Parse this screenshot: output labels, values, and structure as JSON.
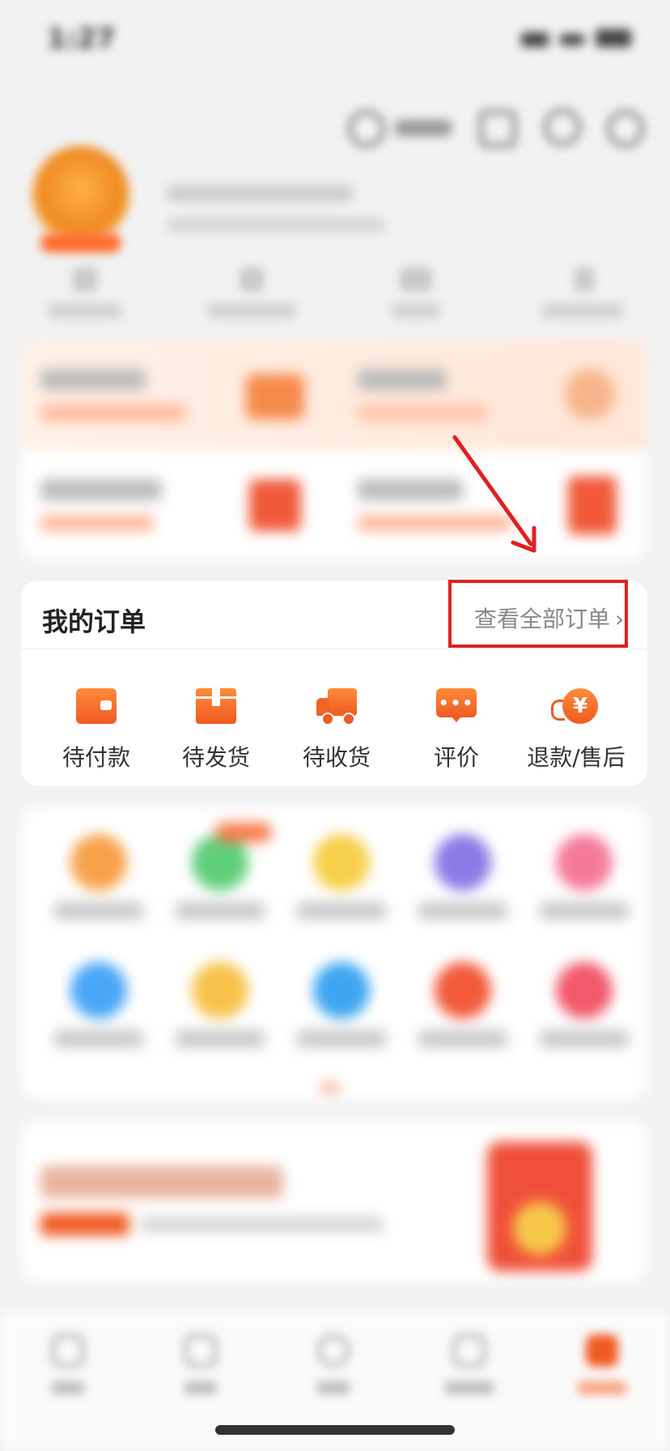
{
  "status": {
    "time": "1:27",
    "battery": ""
  },
  "header": {
    "icons": [
      "scan-icon",
      "edit-icon",
      "search-icon",
      "settings-icon"
    ]
  },
  "profile": {
    "stats": []
  },
  "orders": {
    "title": "我的订单",
    "view_all": "查看全部订单",
    "items": [
      {
        "label": "待付款",
        "icon": "wallet-icon"
      },
      {
        "label": "待发货",
        "icon": "package-icon"
      },
      {
        "label": "待收货",
        "icon": "truck-icon"
      },
      {
        "label": "评价",
        "icon": "chat-icon"
      },
      {
        "label": "退款/售后",
        "icon": "refund-icon"
      }
    ]
  },
  "colors": {
    "accent": "#f05a22",
    "highlight_box": "#e21f1f"
  }
}
